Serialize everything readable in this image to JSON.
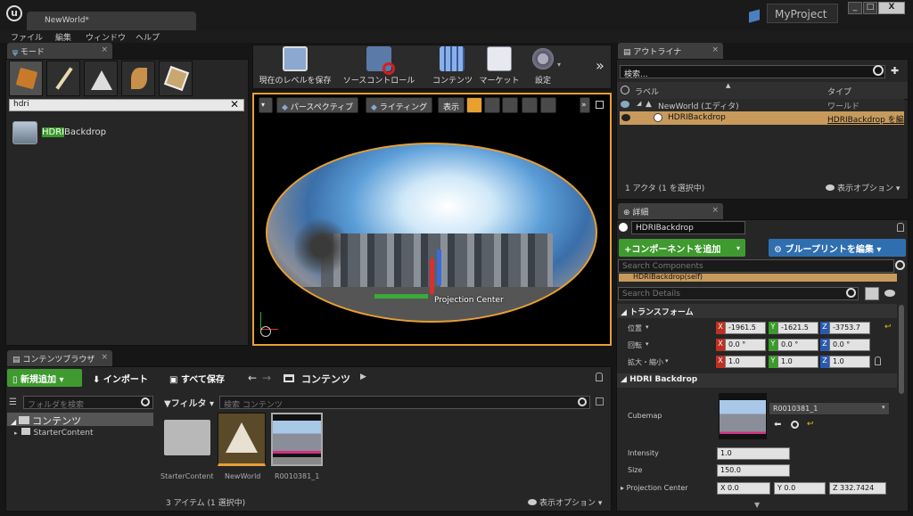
{
  "window": {
    "tab_title": "NewWorld*",
    "project_name": "MyProject",
    "controls": {
      "minimize": "_",
      "maximize": "□",
      "close": "X"
    }
  },
  "menu": [
    "ファイル",
    "編集",
    "ウィンドウ",
    "ヘルプ"
  ],
  "modes": {
    "tab": "モード",
    "search_value": "hdri",
    "result_highlight": "HDRI",
    "result_rest": "Backdrop"
  },
  "toolbar": {
    "items": [
      "現在のレベルを保存",
      "ソースコントロール",
      "コンテンツ",
      "マーケット",
      "設定"
    ],
    "more": "»"
  },
  "viewport": {
    "perspective": "パースペクティブ",
    "lighting": "ライティング",
    "show": "表示",
    "projection_label": "Projection Center"
  },
  "outliner": {
    "tab": "アウトライナ",
    "search_placeholder": "検索...",
    "col_label": "ラベル",
    "col_type": "タイプ",
    "rows": [
      {
        "label": "NewWorld (エディタ)",
        "type": "ワールド"
      },
      {
        "label": "HDRIBackdrop",
        "type": "HDRIBackdrop を編"
      }
    ],
    "status": "1 アクタ (1 を選択中)",
    "view_options": "表示オプション"
  },
  "details": {
    "tab": "詳細",
    "actor_name": "HDRIBackdrop",
    "add_component": "+コンポーネントを追加",
    "edit_blueprint": "ブループリントを編集",
    "search_components": "Search Components",
    "self_item": "HDRIBackdrop(self)",
    "search_details": "Search Details",
    "transform_header": "トランスフォーム",
    "location_label": "位置",
    "location": [
      "-1961.5",
      "-1621.5",
      "-3753.7"
    ],
    "rotation_label": "回転",
    "rotation": [
      "0.0 °",
      "0.0 °",
      "0.0 °"
    ],
    "scale_label": "拡大・縮小",
    "scale": [
      "1.0",
      "1.0",
      "1.0"
    ],
    "hdri_header": "HDRI Backdrop",
    "cubemap_label": "Cubemap",
    "cubemap_value": "R0010381_1",
    "intensity_label": "Intensity",
    "intensity_value": "1.0",
    "size_label": "Size",
    "size_value": "150.0",
    "projection_label": "Projection Center",
    "projection": {
      "x": "X  0.0",
      "y": "Y  0.0",
      "z": "Z  332.7424"
    }
  },
  "content_browser": {
    "tab": "コンテンツブラウザ",
    "add_new": "新規追加",
    "import": "インポート",
    "save_all": "すべて保存",
    "path": "コンテンツ",
    "folder_search_placeholder": "フォルダを検索",
    "filter": "フィルタ",
    "search_placeholder": "検索 コンテンツ",
    "tree": [
      "コンテンツ",
      "StarterContent"
    ],
    "assets": [
      "StarterContent",
      "NewWorld",
      "R0010381_1"
    ],
    "status": "3 アイテム (1 選択中)",
    "view_options": "表示オプション"
  },
  "colors": {
    "accent_orange": "#e8a030",
    "add_green": "#3f9a2f",
    "blueprint_blue": "#2f6fb0",
    "selection": "#c79a5c"
  }
}
